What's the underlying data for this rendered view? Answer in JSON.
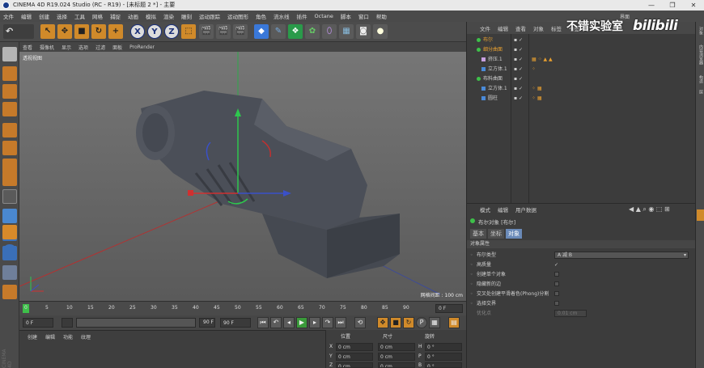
{
  "window": {
    "title": "CINEMA 4D R19.024 Studio (RC - R19) - [未标题 2 *] - 主要",
    "controls": [
      "—",
      "❐",
      "✕"
    ]
  },
  "menubar": [
    "文件",
    "编辑",
    "创建",
    "选择",
    "工具",
    "网格",
    "捕捉",
    "动画",
    "模拟",
    "渲染",
    "雕刻",
    "运动跟踪",
    "运动图形",
    "角色",
    "流水线",
    "插件",
    "Octane",
    "脚本",
    "窗口",
    "帮助"
  ],
  "layout_label": "界面",
  "toolbar": {
    "axis": [
      "X",
      "Y",
      "Z"
    ]
  },
  "viewport": {
    "menu": [
      "查看",
      "摄像机",
      "显示",
      "选项",
      "过滤",
      "面板",
      "ProRender"
    ],
    "label": "透视视图",
    "grid_info": "网格间距 : 100 cm"
  },
  "timeline": {
    "ticks": [
      "0",
      "5",
      "10",
      "15",
      "20",
      "25",
      "30",
      "35",
      "40",
      "45",
      "50",
      "55",
      "60",
      "65",
      "70",
      "75",
      "80",
      "85",
      "90"
    ],
    "current_frame": "0 F"
  },
  "transport": {
    "start": "0 F",
    "preview_start": "0 F",
    "preview_end": "90 F",
    "end": "90 F"
  },
  "materials": {
    "menu": [
      "创建",
      "编辑",
      "功能",
      "纹理"
    ]
  },
  "coordinates": {
    "headers": [
      "位置",
      "尺寸",
      "旋转"
    ],
    "rows": [
      {
        "axis": "X",
        "pos": "0 cm",
        "size": "0 cm",
        "rot_label": "H",
        "rot": "0 °"
      },
      {
        "axis": "Y",
        "pos": "0 cm",
        "size": "0 cm",
        "rot_label": "P",
        "rot": "0 °"
      },
      {
        "axis": "Z",
        "pos": "0 cm",
        "size": "0 cm",
        "rot_label": "B",
        "rot": "0 °"
      }
    ]
  },
  "objects": {
    "menu": [
      "文件",
      "编辑",
      "查看",
      "对象",
      "标签",
      "书签"
    ],
    "tree": [
      {
        "name": "布尔",
        "indent": 0,
        "color": "#e8a030"
      },
      {
        "name": "细分曲面",
        "indent": 0,
        "color": "#e8a030"
      },
      {
        "name": "挤压.1",
        "indent": 1,
        "color": "#cfcfcf"
      },
      {
        "name": "立方体.1",
        "indent": 1,
        "color": "#cfcfcf"
      },
      {
        "name": "布料曲面",
        "indent": 0,
        "color": "#cfcfcf"
      },
      {
        "name": "立方体.1",
        "indent": 1,
        "color": "#cfcfcf"
      },
      {
        "name": "圆柱",
        "indent": 1,
        "color": "#cfcfcf"
      }
    ]
  },
  "attributes": {
    "menu": [
      "模式",
      "编辑",
      "用户数据"
    ],
    "object_title": "布尔对象 [布尔]",
    "tabs": [
      "基本",
      "坐标",
      "对象"
    ],
    "section": "对象属性",
    "rows": [
      {
        "label": "布尔类型",
        "value": "A 减 B",
        "type": "select"
      },
      {
        "label": "高质量",
        "value": "✓",
        "type": "check"
      },
      {
        "label": "创建单个对象",
        "value": "",
        "type": "check"
      },
      {
        "label": "隐藏新的边",
        "value": "",
        "type": "check"
      },
      {
        "label": "交叉处创建平滑着色(Phong)分割",
        "value": "",
        "type": "check"
      },
      {
        "label": "选择交界",
        "value": "",
        "type": "check"
      },
      {
        "label": "优化点",
        "value": "0.01 cm",
        "type": "field"
      }
    ]
  },
  "right_tabs": [
    "对象",
    "内容浏览器",
    "构造",
    "层"
  ],
  "watermark": {
    "text": "不错实验室",
    "logo": "bilibili"
  },
  "brand": "CINEMA 4D"
}
